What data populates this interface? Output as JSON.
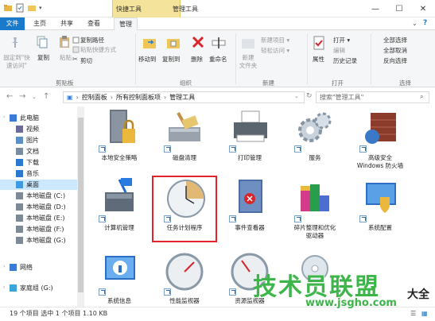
{
  "titlebar": {
    "context_label": "快捷工具",
    "window_title": "管理工具",
    "minimize": "—",
    "maximize": "☐",
    "close": "✕"
  },
  "tabs": [
    {
      "label": "文件"
    },
    {
      "label": "主页"
    },
    {
      "label": "共享"
    },
    {
      "label": "查看"
    },
    {
      "label": "管理"
    }
  ],
  "ribbon": {
    "clipboard": {
      "group": "剪贴板",
      "pin": "固定到\"快速访问\"",
      "copy": "复制",
      "paste": "粘贴",
      "copy_path": "复制路径",
      "paste_shortcut": "粘贴快捷方式",
      "cut": "剪切"
    },
    "organize": {
      "group": "组织",
      "move_to": "移动到",
      "copy_to": "复制到",
      "delete": "删除",
      "rename": "重命名"
    },
    "new": {
      "group": "新建",
      "new_folder": "新建\n文件夹",
      "new_item": "新建项目 ▾",
      "easy_access": "轻松访问 ▾"
    },
    "open": {
      "group": "打开",
      "properties": "属性",
      "open": "打开 ▾",
      "edit": "编辑",
      "history": "历史记录"
    },
    "select": {
      "group": "选择",
      "select_all": "全部选择",
      "select_none": "全部取消",
      "invert": "反向选择"
    }
  },
  "address": {
    "crumbs": [
      "控制面板",
      "所有控制面板项",
      "管理工具"
    ],
    "search_placeholder": "搜索\"管理工具\""
  },
  "nav": [
    {
      "label": "此电脑",
      "color": "#3a7bd5"
    },
    {
      "label": "视频",
      "color": "#6b6b9a"
    },
    {
      "label": "图片",
      "color": "#5a8fc8"
    },
    {
      "label": "文档",
      "color": "#7a8ca0"
    },
    {
      "label": "下载",
      "color": "#2b78d0"
    },
    {
      "label": "音乐",
      "color": "#2b78d0"
    },
    {
      "label": "桌面",
      "color": "#3b9ae1"
    },
    {
      "label": "本地磁盘 (C:)",
      "color": "#7d8a96"
    },
    {
      "label": "本地磁盘 (D:)",
      "color": "#7d8a96"
    },
    {
      "label": "本地磁盘 (E:)",
      "color": "#7d8a96"
    },
    {
      "label": "本地磁盘 (F:)",
      "color": "#7d8a96"
    },
    {
      "label": "本地磁盘 (G:)",
      "color": "#7d8a96"
    },
    {
      "label": "网络",
      "color": "#3a7bd5"
    },
    {
      "label": "家庭组 (G:)",
      "color": "#3ba4d9"
    }
  ],
  "tiles": [
    {
      "label": "本地安全策略"
    },
    {
      "label": "磁盘清理"
    },
    {
      "label": "打印管理"
    },
    {
      "label": "服务"
    },
    {
      "label": "高级安全\nWindows 防火墙"
    },
    {
      "label": "计算机管理"
    },
    {
      "label": "任务计划程序"
    },
    {
      "label": "事件查看器"
    },
    {
      "label": "碎片整理和优化\n驱动器"
    },
    {
      "label": "系统配置"
    },
    {
      "label": "系统信息"
    },
    {
      "label": "性能监视器"
    },
    {
      "label": "资源监视器"
    }
  ],
  "status": {
    "text": "19 个项目   选中 1 个项目  1.10 KB"
  },
  "watermark": {
    "line1": "技术员联盟",
    "line2": "www.jsgho.com",
    "line3": "大全"
  }
}
